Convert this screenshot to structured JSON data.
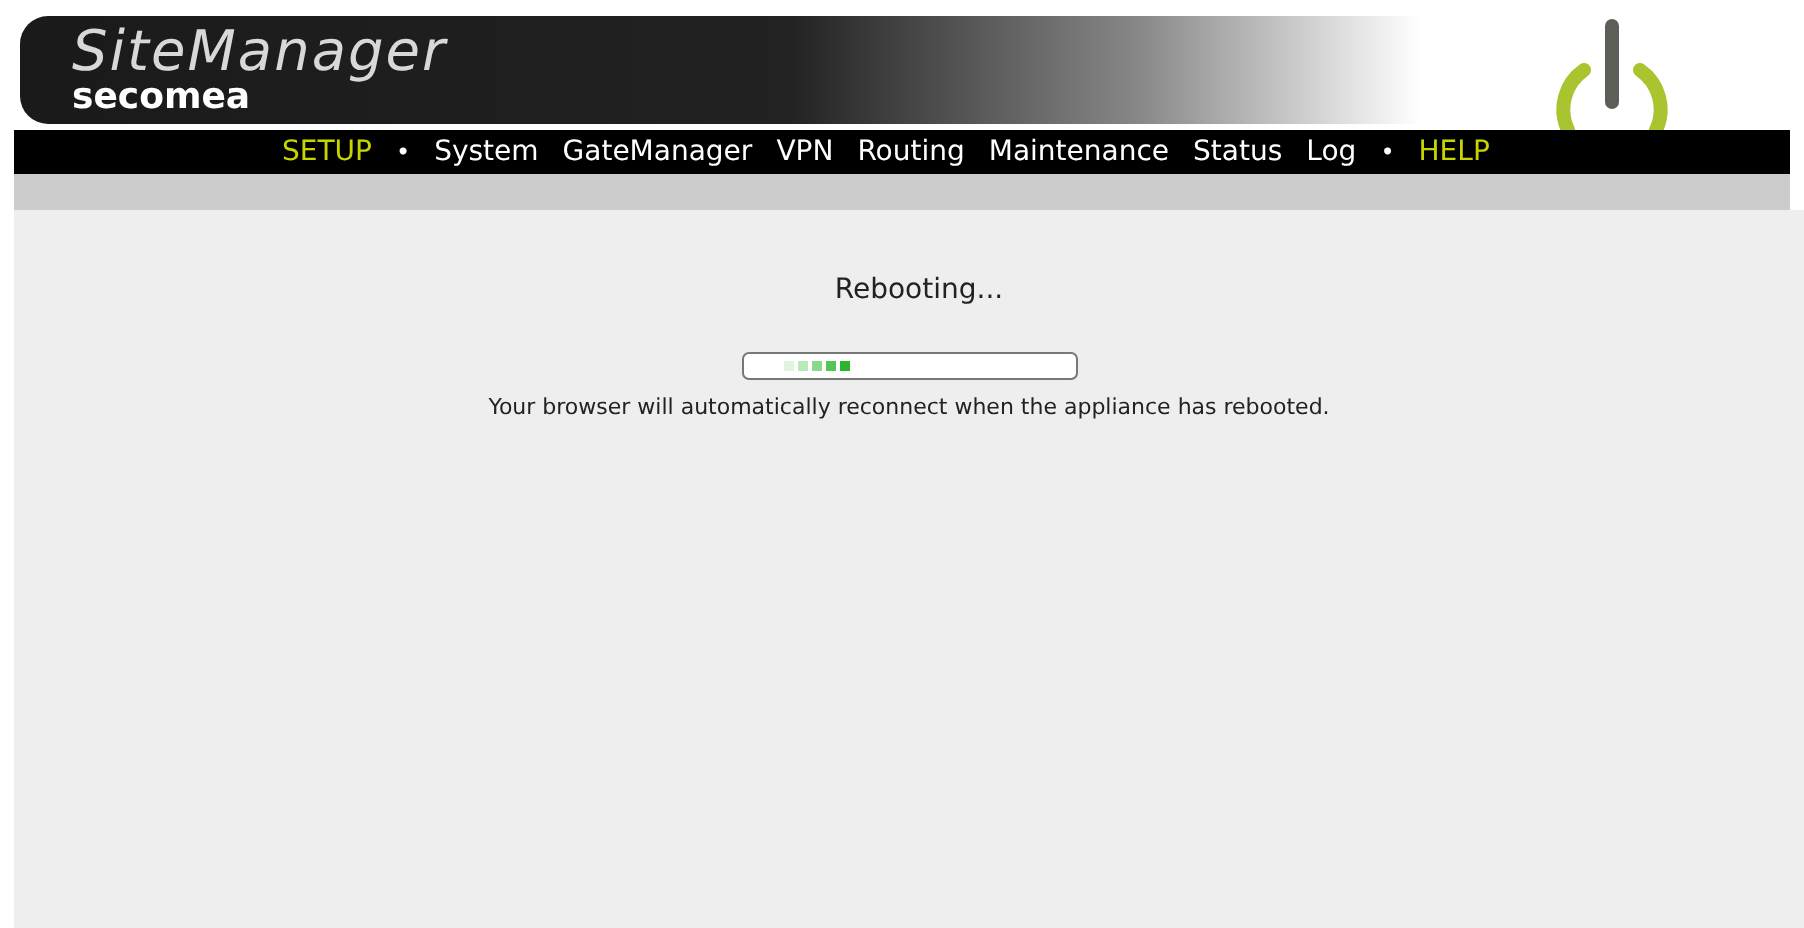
{
  "logo": {
    "product": "SiteManager",
    "brand": "secomea"
  },
  "nav": [
    {
      "label": "SETUP",
      "kind": "section"
    },
    {
      "label": "•",
      "kind": "separator"
    },
    {
      "label": "System",
      "kind": "page"
    },
    {
      "label": "GateManager",
      "kind": "page"
    },
    {
      "label": "VPN",
      "kind": "page"
    },
    {
      "label": "Routing",
      "kind": "page"
    },
    {
      "label": "Maintenance",
      "kind": "page"
    },
    {
      "label": "Status",
      "kind": "page"
    },
    {
      "label": "Log",
      "kind": "page"
    },
    {
      "label": "•",
      "kind": "separator"
    },
    {
      "label": "HELP",
      "kind": "section"
    }
  ],
  "status": {
    "title": "Rebooting...",
    "message": "Your browser will automatically reconnect when the appliance has rebooted."
  }
}
